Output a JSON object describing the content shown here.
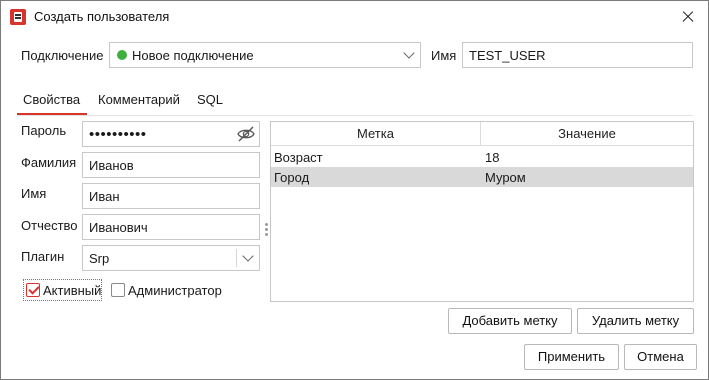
{
  "window": {
    "title": "Создать пользователя",
    "accent": "#d9342b"
  },
  "connection": {
    "label": "Подключение",
    "value": "Новое подключение",
    "status_color": "#3fae3f"
  },
  "name": {
    "label": "Имя",
    "value": "TEST_USER"
  },
  "tabs": [
    {
      "label": "Свойства",
      "active": true
    },
    {
      "label": "Комментарий",
      "active": false
    },
    {
      "label": "SQL",
      "active": false
    }
  ],
  "form": {
    "password": {
      "label": "Пароль",
      "masked_value": "••••••••••",
      "toggle_icon": "eye-slash-icon"
    },
    "last_name": {
      "label": "Фамилия",
      "value": "Иванов"
    },
    "first_name": {
      "label": "Имя",
      "value": "Иван"
    },
    "patronymic": {
      "label": "Отчество",
      "value": "Иванович"
    },
    "plugin": {
      "label": "Плагин",
      "value": "Srp"
    }
  },
  "checkboxes": {
    "active": {
      "label": "Активный",
      "checked": true
    },
    "admin": {
      "label": "Администратор",
      "checked": false
    }
  },
  "tags_table": {
    "columns": [
      "Метка",
      "Значение"
    ],
    "rows": [
      [
        "Возраст",
        "18"
      ],
      [
        "Город",
        "Муром"
      ]
    ],
    "selected_row": 1
  },
  "buttons": {
    "add_tag": "Добавить метку",
    "remove_tag": "Удалить метку",
    "apply": "Применить",
    "cancel": "Отмена"
  }
}
